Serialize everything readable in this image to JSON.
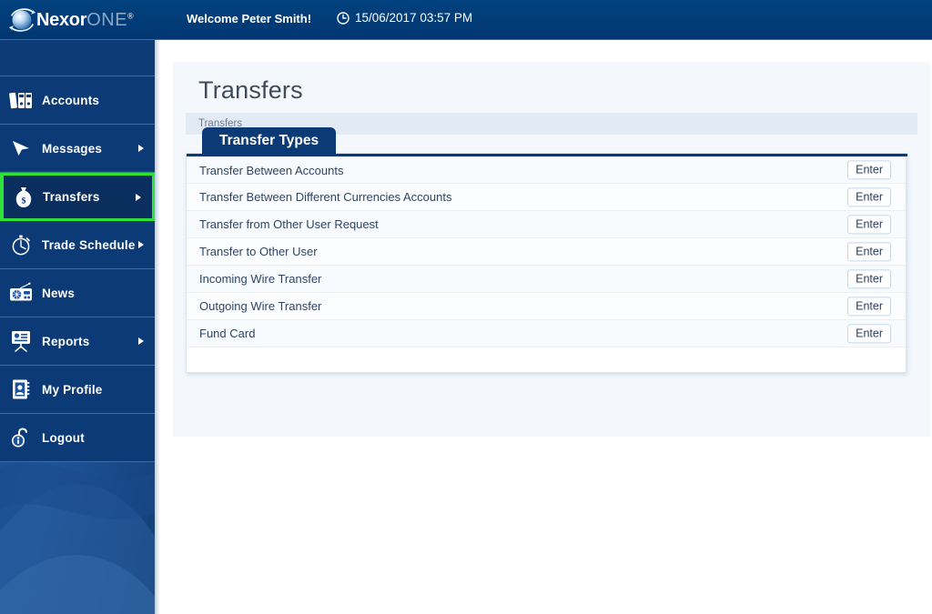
{
  "header": {
    "logo": {
      "primary": "Nexor",
      "secondary": "ONE",
      "registered": "®",
      "icon": "nexor-sphere-swoosh-icon"
    },
    "welcome_prefix": "Welcome ",
    "user_name": "Peter Smith!",
    "clock_icon": "clock-icon",
    "datetime": "15/06/2017 03:57 PM"
  },
  "sidebar": {
    "items": [
      {
        "label": "Accounts",
        "icon": "binders-icon",
        "has_arrow": false,
        "selected": false
      },
      {
        "label": "Messages",
        "icon": "cursor-arrow-icon",
        "has_arrow": true,
        "selected": false
      },
      {
        "label": "Transfers",
        "icon": "money-bag-icon",
        "has_arrow": true,
        "selected": true
      },
      {
        "label": "Trade Schedule",
        "icon": "stopwatch-icon",
        "has_arrow": true,
        "selected": false
      },
      {
        "label": "News",
        "icon": "radio-icon",
        "has_arrow": false,
        "selected": false
      },
      {
        "label": "Reports",
        "icon": "presentation-icon",
        "has_arrow": true,
        "selected": false
      },
      {
        "label": "My Profile",
        "icon": "address-book-icon",
        "has_arrow": false,
        "selected": false
      },
      {
        "label": "Logout",
        "icon": "open-padlock-icon",
        "has_arrow": false,
        "selected": false
      }
    ],
    "selected_highlight_color": "#2ee23a"
  },
  "main": {
    "page_title": "Transfers",
    "breadcrumb": "Transfers",
    "tab_label": "Transfer Types",
    "enter_label": "Enter",
    "transfer_types": [
      "Transfer Between Accounts",
      "Transfer Between Different Currencies Accounts",
      "Transfer from Other User Request",
      "Transfer to Other User",
      "Incoming Wire Transfer",
      "Outgoing Wire Transfer",
      "Fund Card"
    ]
  },
  "colors": {
    "header_blue": "#013A78",
    "nav_blue": "#0b3a76",
    "sidebar_blue": "#1c4f8f",
    "accent_green": "#2ee23a",
    "panel_bg": "#f4f8fc",
    "breadcrumb_bg": "#e2eaf4"
  }
}
